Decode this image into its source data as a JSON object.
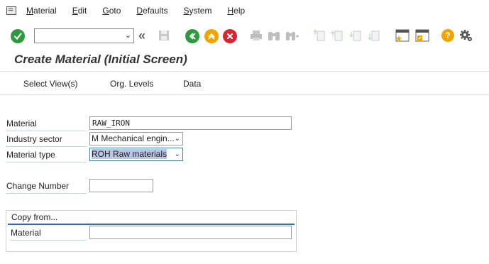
{
  "menu": {
    "items": [
      {
        "first": "M",
        "rest": "aterial"
      },
      {
        "first": "E",
        "rest": "dit"
      },
      {
        "first": "G",
        "rest": "oto"
      },
      {
        "first": "D",
        "rest": "efaults"
      },
      {
        "first": "S",
        "rest": "ystem"
      },
      {
        "first": "H",
        "rest": "elp"
      }
    ]
  },
  "toolbar": {
    "command_value": "",
    "icons": [
      "enter-icon",
      "command-field",
      "back-double-icon",
      "save-icon",
      "back-icon",
      "exit-icon",
      "cancel-icon",
      "print-icon",
      "find-icon",
      "find-next-icon",
      "first-page-icon",
      "prev-page-icon",
      "next-page-icon",
      "last-page-icon",
      "new-session-icon",
      "shortcut-icon",
      "help-icon",
      "settings-icon"
    ]
  },
  "page": {
    "title": "Create Material (Initial Screen)"
  },
  "appbar": {
    "select_views": "Select View(s)",
    "org_levels": "Org. Levels",
    "data": "Data"
  },
  "form": {
    "material_label": "Material",
    "material_value": "RAW_IRON",
    "industry_label": "Industry sector",
    "industry_value": "M Mechanical engin...",
    "type_label": "Material type",
    "type_value": "ROH Raw materials",
    "change_label": "Change Number",
    "change_value": ""
  },
  "copy_from": {
    "title": "Copy from...",
    "material_label": "Material",
    "material_value": ""
  },
  "colors": {
    "enter": "#2e9a3e",
    "exit": "#f0a400",
    "cancel": "#d9252f",
    "section_line": "#2a6fb0",
    "selection": "#b8c7e3"
  }
}
